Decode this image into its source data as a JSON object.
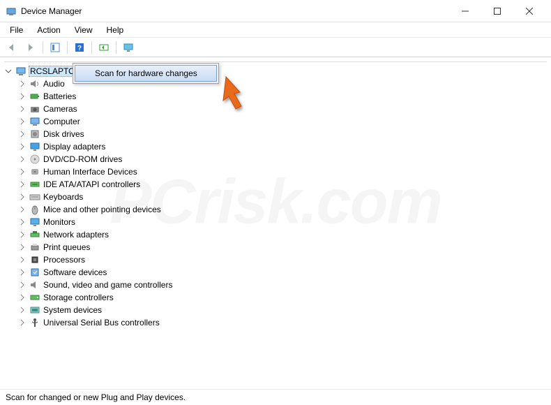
{
  "window": {
    "title": "Device Manager"
  },
  "menu": {
    "file": "File",
    "action": "Action",
    "view": "View",
    "help": "Help"
  },
  "tree": {
    "root": "RCSLAPTOP",
    "items": [
      {
        "label": "Audio",
        "icon": "speaker"
      },
      {
        "label": "Batteries",
        "icon": "battery"
      },
      {
        "label": "Cameras",
        "icon": "camera"
      },
      {
        "label": "Computer",
        "icon": "computer"
      },
      {
        "label": "Disk drives",
        "icon": "disk"
      },
      {
        "label": "Display adapters",
        "icon": "display"
      },
      {
        "label": "DVD/CD-ROM drives",
        "icon": "cd"
      },
      {
        "label": "Human Interface Devices",
        "icon": "hid"
      },
      {
        "label": "IDE ATA/ATAPI controllers",
        "icon": "ide"
      },
      {
        "label": "Keyboards",
        "icon": "keyboard"
      },
      {
        "label": "Mice and other pointing devices",
        "icon": "mouse"
      },
      {
        "label": "Monitors",
        "icon": "monitor"
      },
      {
        "label": "Network adapters",
        "icon": "network"
      },
      {
        "label": "Print queues",
        "icon": "printer"
      },
      {
        "label": "Processors",
        "icon": "cpu"
      },
      {
        "label": "Software devices",
        "icon": "software"
      },
      {
        "label": "Sound, video and game controllers",
        "icon": "sound"
      },
      {
        "label": "Storage controllers",
        "icon": "storage"
      },
      {
        "label": "System devices",
        "icon": "system"
      },
      {
        "label": "Universal Serial Bus controllers",
        "icon": "usb"
      }
    ]
  },
  "context_menu": {
    "item": "Scan for hardware changes"
  },
  "statusbar": {
    "text": "Scan for changed or new Plug and Play devices."
  },
  "watermark": "PCrisk.com"
}
